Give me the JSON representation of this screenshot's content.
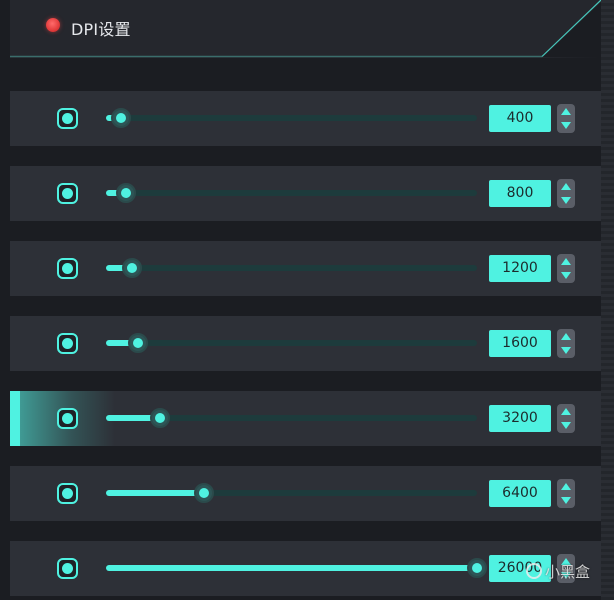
{
  "header": {
    "title": "DPI设置",
    "status_color": "#e23b3b"
  },
  "accent_color": "#4ff2e1",
  "dpi_levels": [
    {
      "value": "400",
      "slider_fraction": 0.04,
      "selected": false
    },
    {
      "value": "800",
      "slider_fraction": 0.055,
      "selected": false
    },
    {
      "value": "1200",
      "slider_fraction": 0.07,
      "selected": false
    },
    {
      "value": "1600",
      "slider_fraction": 0.085,
      "selected": false
    },
    {
      "value": "3200",
      "slider_fraction": 0.145,
      "selected": true
    },
    {
      "value": "6400",
      "slider_fraction": 0.265,
      "selected": false
    },
    {
      "value": "26000",
      "slider_fraction": 1.0,
      "selected": false
    }
  ],
  "watermark": {
    "text": "小黑盒"
  }
}
